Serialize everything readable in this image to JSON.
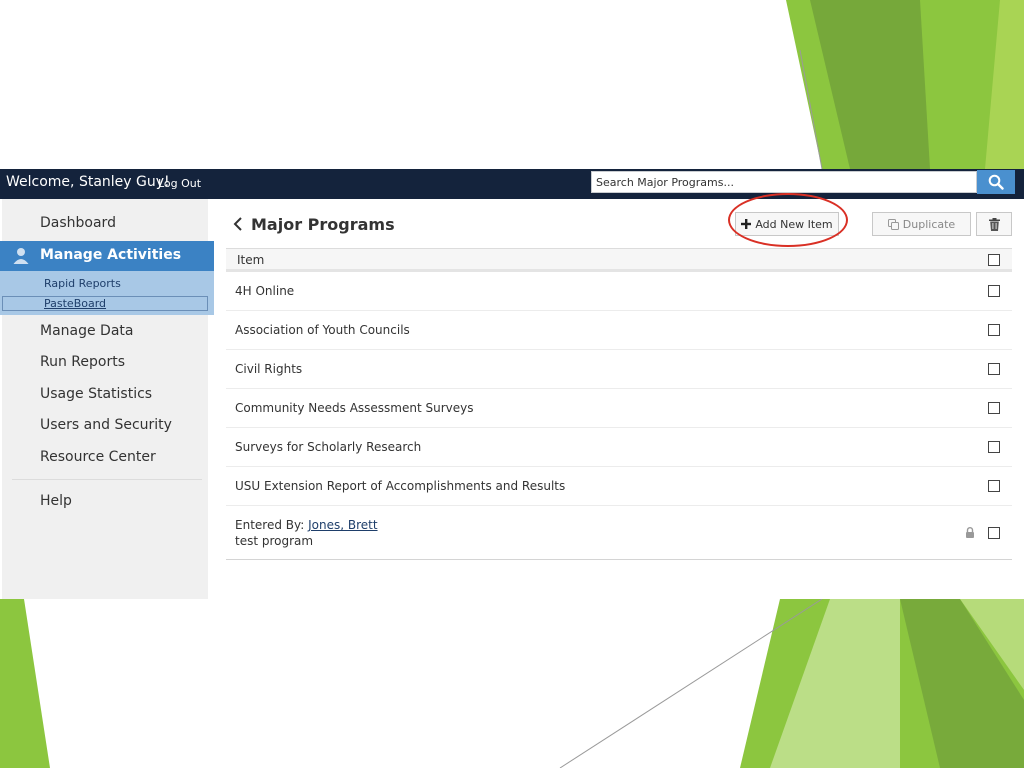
{
  "colors": {
    "topbar": "#14233c",
    "accent": "#3b82c4",
    "subnav": "#a8c8e6",
    "search_button": "#4a90cf",
    "highlight": "#d93025",
    "slide_green": "#8cc63f"
  },
  "header": {
    "welcome": "Welcome, Stanley Guy!",
    "logout": "Log Out",
    "search_placeholder": "Search Major Programs...",
    "search_icon": "search-icon"
  },
  "sidebar": {
    "items": [
      {
        "label": "Dashboard"
      },
      {
        "label": "Manage Activities",
        "active": true,
        "icon": "user-icon"
      },
      {
        "label": "Manage Data"
      },
      {
        "label": "Run Reports"
      },
      {
        "label": "Usage Statistics"
      },
      {
        "label": "Users and Security"
      },
      {
        "label": "Resource Center"
      },
      {
        "label": "Help"
      }
    ],
    "subitems": [
      {
        "label": "Rapid Reports"
      },
      {
        "label": "PasteBoard",
        "current": true
      }
    ]
  },
  "main": {
    "title": "Major Programs",
    "back_icon": "chevron-left-icon",
    "buttons": {
      "add": "Add New Item",
      "duplicate": "Duplicate",
      "delete_icon": "trash-icon"
    },
    "table": {
      "header": "Item",
      "rows": [
        {
          "name": "4H Online"
        },
        {
          "name": "Association of Youth Councils"
        },
        {
          "name": "Civil Rights"
        },
        {
          "name": "Community Needs Assessment Surveys"
        },
        {
          "name": "Surveys for Scholarly Research"
        },
        {
          "name": "USU Extension Report of Accomplishments and Results"
        }
      ],
      "entered_row": {
        "prefix": "Entered By:",
        "author": "Jones, Brett",
        "name": "test program",
        "lock_icon": "lock-icon"
      }
    }
  }
}
